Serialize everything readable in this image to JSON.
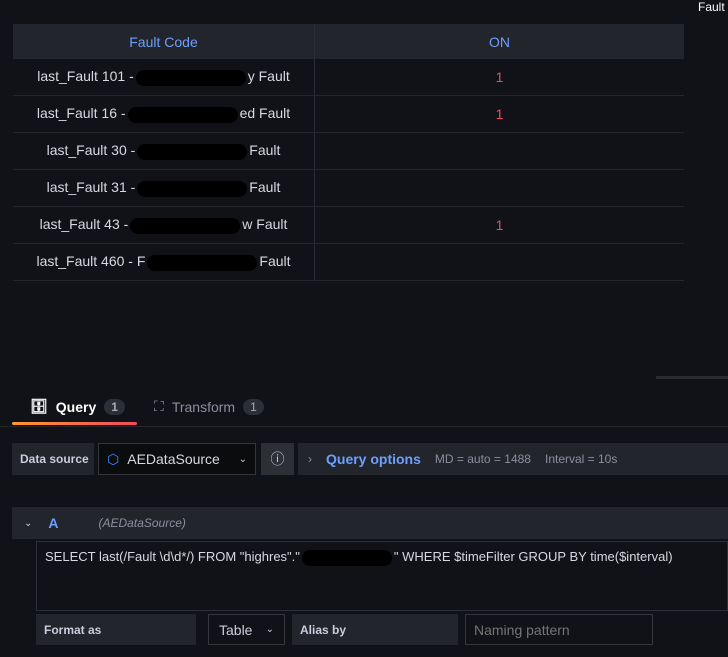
{
  "corner_label": "Fault",
  "table": {
    "headers": [
      "Fault Code",
      "ON"
    ],
    "rows": [
      {
        "prefix": "last_Fault 101 -",
        "suffix": "y Fault",
        "on": "1"
      },
      {
        "prefix": "last_Fault 16 -",
        "suffix": "ed Fault",
        "on": "1"
      },
      {
        "prefix": "last_Fault 30 -",
        "suffix": "Fault",
        "on": ""
      },
      {
        "prefix": "last_Fault 31 -",
        "suffix": "Fault",
        "on": ""
      },
      {
        "prefix": "last_Fault 43 -",
        "suffix": "w Fault",
        "on": "1"
      },
      {
        "prefix": "last_Fault 460 - F",
        "suffix": "Fault",
        "on": ""
      }
    ]
  },
  "tabs": [
    {
      "label": "Query",
      "count": "1"
    },
    {
      "label": "Transform",
      "count": "1"
    }
  ],
  "datasource": {
    "label": "Data source",
    "value": "AEDataSource"
  },
  "query_options": {
    "label": "Query options",
    "md": "MD = auto = 1488",
    "interval": "Interval = 10s"
  },
  "query": {
    "ref": "A",
    "source": "(AEDataSource)",
    "sql_start": "SELECT last(/Fault \\d\\d*/) FROM \"highres\".\"",
    "sql_end": "\" WHERE $timeFilter GROUP BY time($interval)"
  },
  "format": {
    "label": "Format as",
    "value": "Table",
    "alias_label": "Alias by",
    "alias_placeholder": "Naming pattern"
  },
  "colors": {
    "accent": "#6e9fff",
    "on": "#f2495c"
  }
}
